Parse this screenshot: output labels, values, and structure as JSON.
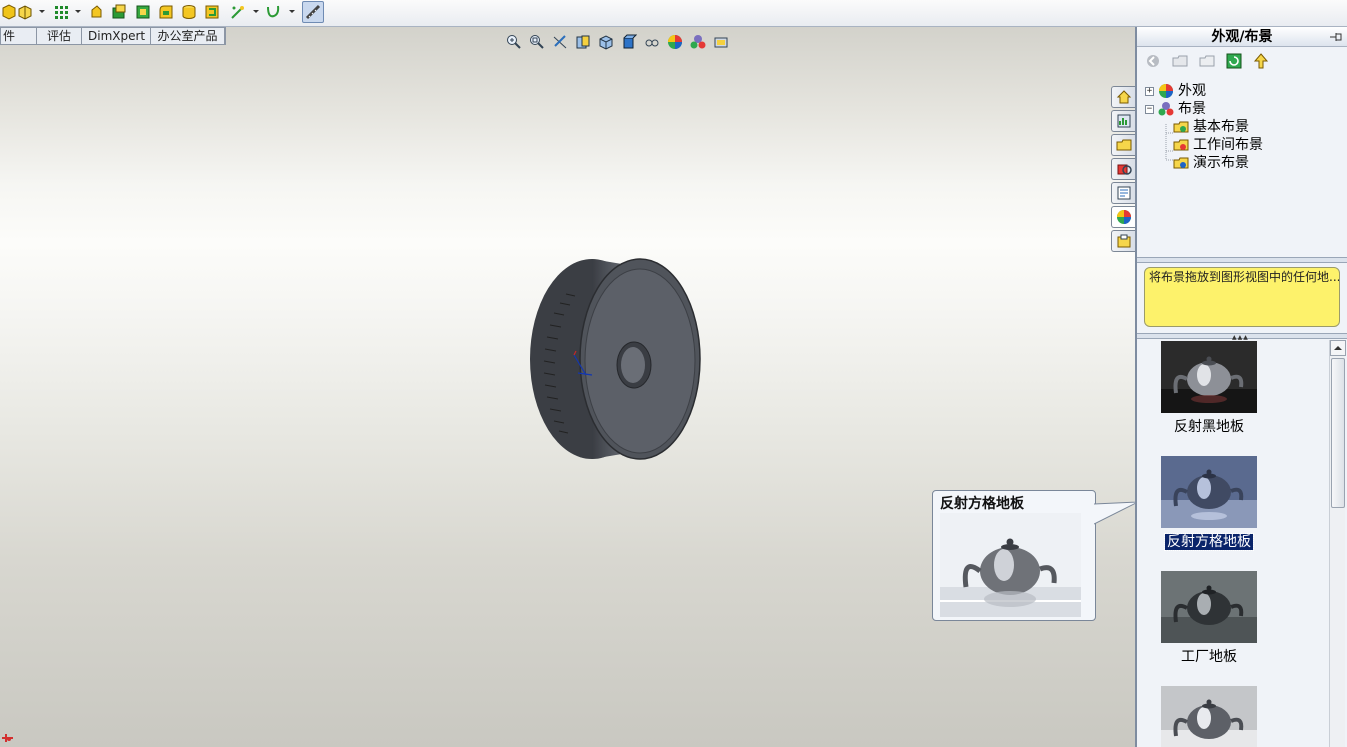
{
  "window": {
    "title": ""
  },
  "toolbar": {
    "icons": [
      "part-icon",
      "assembly-icon",
      "linear-pattern-icon",
      "extrude-icon",
      "cut-icon",
      "shell-icon",
      "fillet-icon",
      "cylinder-icon",
      "sheet-icon",
      "sketch-icon",
      "curve-icon",
      "ruler-icon"
    ]
  },
  "command_tabs": {
    "items": [
      {
        "label": "件"
      },
      {
        "label": "评估"
      },
      {
        "label": "DimXpert"
      },
      {
        "label": "办公室产品"
      }
    ]
  },
  "view_hud": {
    "icons": [
      "zoom-to-fit-icon",
      "zoom-area-icon",
      "previous-view-icon",
      "section-view-icon",
      "view-orientation-icon",
      "display-style-icon",
      "hide-show-icon",
      "edit-appearance-icon",
      "apply-scene-icon",
      "view-settings-icon"
    ]
  },
  "task_pane": {
    "title": "外观/布景",
    "tabs": [
      "home-tab",
      "resources-tab",
      "design-library-tab",
      "file-explorer-tab",
      "search-tab",
      "appearances-tab",
      "custom-properties-tab"
    ],
    "tree": [
      {
        "label": "外观",
        "expander": "+",
        "level": 0
      },
      {
        "label": "布景",
        "expander": "−",
        "level": 0
      },
      {
        "label": "基本布景",
        "level": 1
      },
      {
        "label": "工作间布景",
        "level": 1
      },
      {
        "label": "演示布景",
        "level": 1
      }
    ],
    "hint": "将布景拖放到图形视图中的任何地...",
    "gallery": [
      {
        "label": "反射黑地板",
        "selected": false
      },
      {
        "label": "反射方格地板",
        "selected": true
      },
      {
        "label": "工厂地板",
        "selected": false
      },
      {
        "label": "",
        "selected": false
      }
    ]
  },
  "tooltip": {
    "title": "反射方格地板"
  },
  "colors": {
    "accent": "#0a246a",
    "hint_bg": "#fdf26b",
    "panel_bg": "#f0f3f8",
    "part": "#4b4f57"
  }
}
